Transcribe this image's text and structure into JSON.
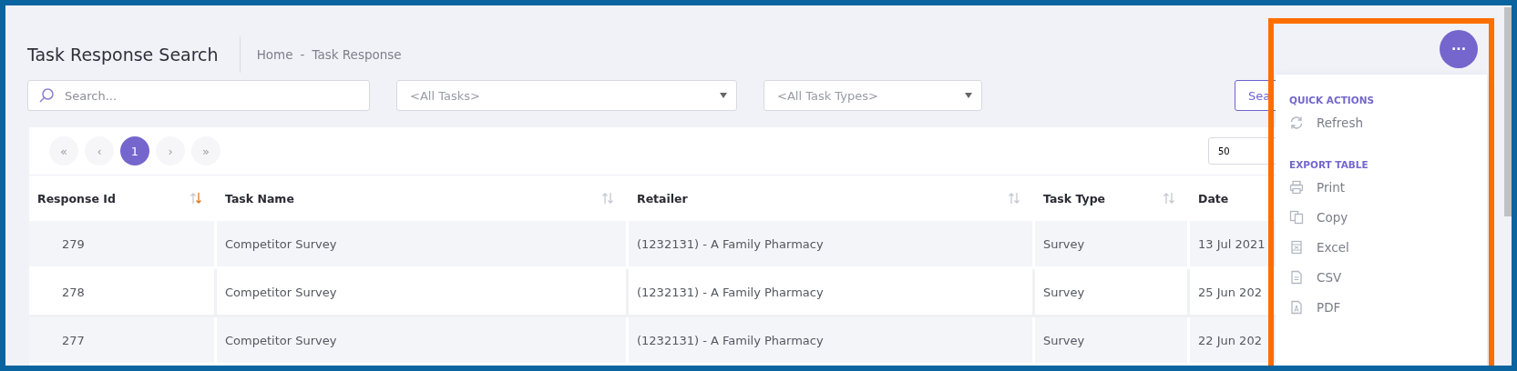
{
  "page": {
    "title": "Task Response Search",
    "breadcrumb": [
      "Home",
      "Task Response"
    ],
    "breadcrumb_separator": "-"
  },
  "filters": {
    "search": {
      "placeholder": "Search..."
    },
    "task": {
      "value": "<All Tasks>"
    },
    "task_type": {
      "value": "<All Task Types>"
    },
    "search_button": "Sea"
  },
  "pager": [
    {
      "label": "«",
      "disabled": true,
      "selected": false
    },
    {
      "label": "‹",
      "disabled": true,
      "selected": false
    },
    {
      "label": "1",
      "disabled": false,
      "selected": true
    },
    {
      "label": "›",
      "disabled": true,
      "selected": false
    },
    {
      "label": "»",
      "disabled": true,
      "selected": false
    }
  ],
  "page_size": "50",
  "table": {
    "columns": [
      {
        "label": "Response Id",
        "sorted": true
      },
      {
        "label": "Task Name",
        "sorted": false
      },
      {
        "label": "Retailer",
        "sorted": false
      },
      {
        "label": "Task Type",
        "sorted": false
      },
      {
        "label": "Date"
      }
    ],
    "rows": [
      [
        "279",
        "Competitor Survey",
        "(1232131) - A Family Pharmacy",
        "Survey",
        "13 Jul 2021"
      ],
      [
        "278",
        "Competitor Survey",
        "(1232131) - A Family Pharmacy",
        "Survey",
        "25 Jun 202"
      ],
      [
        "277",
        "Competitor Survey",
        "(1232131) - A Family Pharmacy",
        "Survey",
        "22 Jun 202"
      ]
    ]
  },
  "menu": {
    "button": "···",
    "sections": [
      {
        "title": "QUICK ACTIONS",
        "items": [
          {
            "label": "Refresh",
            "kind": "refresh"
          }
        ]
      },
      {
        "title": "EXPORT TABLE",
        "items": [
          {
            "label": "Print",
            "kind": "print"
          },
          {
            "label": "Copy",
            "kind": "copy"
          },
          {
            "label": "Excel",
            "kind": "excel"
          },
          {
            "label": "CSV",
            "kind": "csv"
          },
          {
            "label": "PDF",
            "kind": "pdf"
          }
        ]
      }
    ]
  }
}
